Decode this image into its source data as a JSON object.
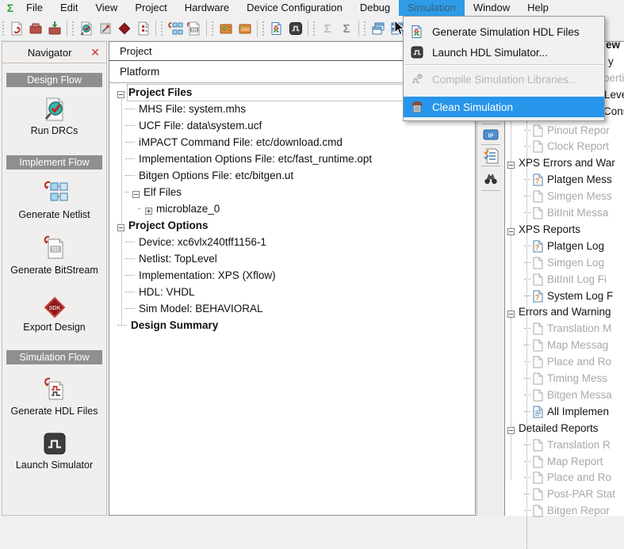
{
  "menu_bar": {
    "app_icon": "sigma-icon",
    "items": [
      "File",
      "Edit",
      "View",
      "Project",
      "Hardware",
      "Device Configuration",
      "Debug",
      "Simulation",
      "Window",
      "Help"
    ],
    "active_item": "Simulation"
  },
  "toolbar": {
    "groups": [
      [
        "save-file-icon",
        "open-project-icon",
        "import-design-icon"
      ],
      [
        "run-drcs-icon",
        "view-ports-icon",
        "export-sdk-icon",
        "debug-module-icon"
      ],
      [
        "generate-netlist-icon",
        "generate-bitstream-icon"
      ],
      [
        "program-device-icon",
        "download-bitstream-icon"
      ],
      [
        "generate-sim-hdl-icon",
        "launch-simulator-icon"
      ],
      [
        "sigma-light-icon",
        "sigma-dark-icon"
      ],
      [
        "cascade-windows-icon",
        "tile-horizontal-icon",
        "tile-vertical-icon"
      ]
    ]
  },
  "navigator": {
    "title": "Navigator",
    "close_icon": "close-icon",
    "sections": [
      {
        "header": "Design Flow",
        "items": [
          {
            "label": "Run DRCs",
            "icon": "run-drcs-icon"
          }
        ]
      },
      {
        "header": "Implement Flow",
        "items": [
          {
            "label": "Generate Netlist",
            "icon": "generate-netlist-icon"
          },
          {
            "label": "Generate BitStream",
            "icon": "generate-bitstream-icon"
          },
          {
            "label": "Export Design",
            "icon": "export-design-icon"
          }
        ]
      },
      {
        "header": "Simulation Flow",
        "items": [
          {
            "label": "Generate HDL Files",
            "icon": "generate-hdl-files-icon"
          },
          {
            "label": "Launch Simulator",
            "icon": "launch-simulator-icon"
          }
        ]
      }
    ]
  },
  "project_panel": {
    "tab_label": "Project",
    "subheader": "Platform",
    "tree": [
      {
        "label": "Project Files",
        "bold": true,
        "level": 0,
        "exp": "minus",
        "focused": true
      },
      {
        "label": "MHS File: system.mhs",
        "level": 1
      },
      {
        "label": "UCF File: data\\system.ucf",
        "level": 1
      },
      {
        "label": "iMPACT Command File: etc/download.cmd",
        "level": 1
      },
      {
        "label": "Implementation Options File: etc/fast_runtime.opt",
        "level": 1
      },
      {
        "label": "Bitgen Options File: etc/bitgen.ut",
        "level": 1
      },
      {
        "label": "Elf Files",
        "level": 1,
        "exp": "minus"
      },
      {
        "label": "microblaze_0",
        "level": 2,
        "exp": "plus"
      },
      {
        "label": "Project Options",
        "bold": true,
        "level": 0,
        "exp": "minus"
      },
      {
        "label": "Device: xc6vlx240tff1156-1",
        "level": 1
      },
      {
        "label": "Netlist: TopLevel",
        "level": 1
      },
      {
        "label": "Implementation: XPS (Xflow)",
        "level": 1
      },
      {
        "label": "HDL: VHDL",
        "level": 1
      },
      {
        "label": "Sim Model: BEHAVIORAL",
        "level": 1
      },
      {
        "label": "Design Summary",
        "bold": true,
        "level": 0
      }
    ]
  },
  "simulation_menu": {
    "items": [
      {
        "label": "Generate Simulation HDL Files",
        "icon": "generate-sim-hdl-icon"
      },
      {
        "label": "Launch HDL Simulator...",
        "icon": "launch-hdl-simulator-icon"
      },
      {
        "separator": true
      },
      {
        "label": "Compile Simulation Libraries...",
        "icon": "compile-libraries-icon",
        "disabled": true
      },
      {
        "label": "Clean Simulation",
        "icon": "clean-simulation-icon",
        "highlighted": true
      }
    ]
  },
  "side_strip": {
    "icons": [
      "ip-catalog-icon",
      "checklist-icon",
      "binoculars-icon"
    ]
  },
  "right_panel": {
    "rows": [
      {
        "fragment": "ew",
        "bold": true
      },
      {
        "fragment": "y"
      },
      {
        "fragment": "berti",
        "disabled": true
      },
      {
        "fragment": "Leve"
      },
      {
        "fragment": "Const"
      },
      {
        "label": "Pinout Repor",
        "type": "child",
        "icon": "doc",
        "disabled": true
      },
      {
        "label": "Clock Report",
        "type": "child",
        "icon": "doc",
        "disabled": true
      },
      {
        "label": "XPS Errors and War",
        "type": "group"
      },
      {
        "label": "Platgen Mess",
        "type": "child",
        "icon": "doc-question"
      },
      {
        "label": "Simgen Mess",
        "type": "child",
        "icon": "doc",
        "disabled": true
      },
      {
        "label": "BitInit Messa",
        "type": "child",
        "icon": "doc",
        "disabled": true
      },
      {
        "label": "XPS Reports",
        "type": "group"
      },
      {
        "label": "Platgen Log",
        "type": "child",
        "icon": "doc-question"
      },
      {
        "label": "Simgen Log",
        "type": "child",
        "icon": "doc",
        "disabled": true
      },
      {
        "label": "BitInit Log Fi",
        "type": "child",
        "icon": "doc",
        "disabled": true
      },
      {
        "label": "System Log F",
        "type": "child",
        "icon": "doc-question"
      },
      {
        "label": "Errors and Warning",
        "type": "group"
      },
      {
        "label": "Translation M",
        "type": "child",
        "icon": "doc",
        "disabled": true
      },
      {
        "label": "Map Messag",
        "type": "child",
        "icon": "doc",
        "disabled": true
      },
      {
        "label": "Place and Ro",
        "type": "child",
        "icon": "doc",
        "disabled": true
      },
      {
        "label": "Timing Mess",
        "type": "child",
        "icon": "doc",
        "disabled": true
      },
      {
        "label": "Bitgen Messa",
        "type": "child",
        "icon": "doc",
        "disabled": true
      },
      {
        "label": "All Implemen",
        "type": "child",
        "icon": "doc-lines"
      },
      {
        "label": "Detailed Reports",
        "type": "group"
      },
      {
        "label": "Translation R",
        "type": "child",
        "icon": "doc",
        "disabled": true
      },
      {
        "label": "Map Report",
        "type": "child",
        "icon": "doc",
        "disabled": true
      },
      {
        "label": "Place and Ro",
        "type": "child",
        "icon": "doc",
        "disabled": true
      },
      {
        "label": "Post-PAR Stat",
        "type": "child",
        "icon": "doc",
        "disabled": true
      },
      {
        "label": "Bitgen Repor",
        "type": "child",
        "icon": "doc",
        "disabled": true
      }
    ]
  },
  "colors": {
    "menu_highlight": "#2e9ce8",
    "selection": "#2795e9",
    "section_header": "#8f8f8f",
    "disabled_text": "#a8a8a8",
    "navigator_bg": "#f1efee"
  }
}
